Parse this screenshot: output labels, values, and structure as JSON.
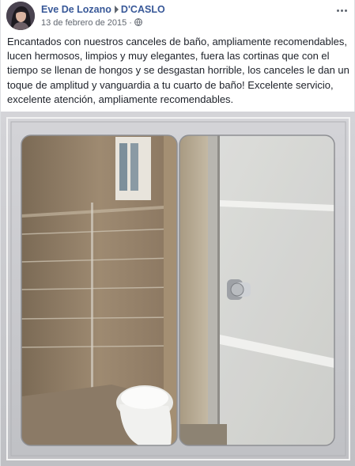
{
  "post": {
    "author": "Eve De Lozano",
    "page": "D'CASLO",
    "date": "13 de febrero de 2015",
    "separator": "·",
    "text": "Encantados con nuestros canceles de baño, ampliamente recomendables, lucen hermosos, limpios y muy elegantes, fuera las cortinas que con el tiempo se llenan de hongos y se desgastan horrible, los canceles le dan un toque de amplitud y vanguardia a tu cuarto de baño! Excelente servicio, excelente atención, ampliamente recomendables."
  },
  "icons": {
    "audience": "globe-icon",
    "menu": "more-options-icon",
    "separator": "right-triangle-icon"
  },
  "colors": {
    "link": "#385898",
    "text": "#1d2129",
    "meta": "#616770"
  }
}
